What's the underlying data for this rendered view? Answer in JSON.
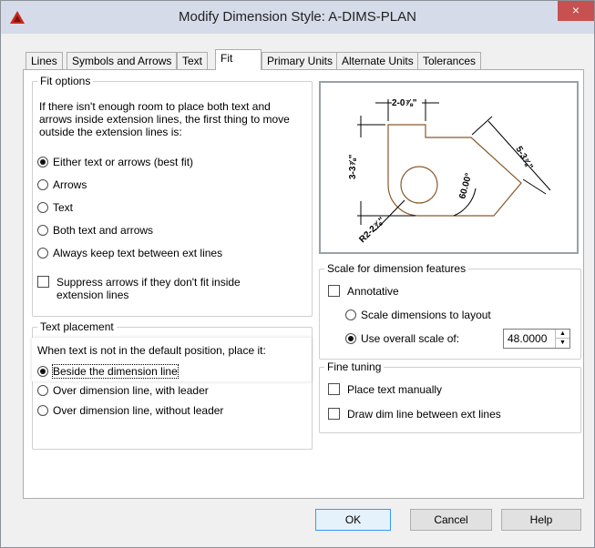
{
  "window": {
    "title": "Modify Dimension Style: A-DIMS-PLAN",
    "close_glyph": "×"
  },
  "tabs": [
    {
      "label": "Lines",
      "active": false
    },
    {
      "label": "Symbols and Arrows",
      "active": false
    },
    {
      "label": "Text",
      "active": false
    },
    {
      "label": "Fit",
      "active": true
    },
    {
      "label": "Primary Units",
      "active": false
    },
    {
      "label": "Alternate Units",
      "active": false
    },
    {
      "label": "Tolerances",
      "active": false
    }
  ],
  "fit_options": {
    "legend": "Fit options",
    "description": "If there isn't enough room to place both text and arrows inside extension lines, the first thing to move outside the extension lines is:",
    "radios": [
      {
        "label": "Either text or arrows (best fit)",
        "checked": true
      },
      {
        "label": "Arrows",
        "checked": false
      },
      {
        "label": "Text",
        "checked": false
      },
      {
        "label": "Both text and arrows",
        "checked": false
      },
      {
        "label": "Always keep text between ext lines",
        "checked": false
      }
    ],
    "suppress_label": "Suppress arrows if they don't fit inside extension lines",
    "suppress_checked": false
  },
  "text_placement": {
    "legend": "Text placement",
    "description": "When text is not in the default position, place it:",
    "radios": [
      {
        "label": "Beside the dimension line",
        "checked": true
      },
      {
        "label": "Over dimension line, with leader",
        "checked": false
      },
      {
        "label": "Over dimension line, without leader",
        "checked": false
      }
    ]
  },
  "preview": {
    "dim_top": "2-0⅞\"",
    "dim_left": "3-3⅞\"",
    "dim_right": "5-3⅞\"",
    "dim_angle": "60.00°",
    "dim_radius": "R2-2⅞\""
  },
  "scale": {
    "legend": "Scale for dimension features",
    "annotative_label": "Annotative",
    "annotative_checked": false,
    "layout_label": "Scale dimensions to layout",
    "layout_checked": false,
    "overall_label": "Use overall scale of:",
    "overall_checked": true,
    "overall_value": "48.0000"
  },
  "fine_tuning": {
    "legend": "Fine tuning",
    "place_manual_label": "Place text manually",
    "place_manual_checked": false,
    "draw_dim_label": "Draw dim line between ext lines",
    "draw_dim_checked": false
  },
  "buttons": {
    "ok": "OK",
    "cancel": "Cancel",
    "help": "Help"
  },
  "colors": {
    "title_bar": "#d6dbe9",
    "close_button": "#c75050",
    "preview_shape": "#8b5a2b",
    "default_button_border": "#3399ff"
  }
}
